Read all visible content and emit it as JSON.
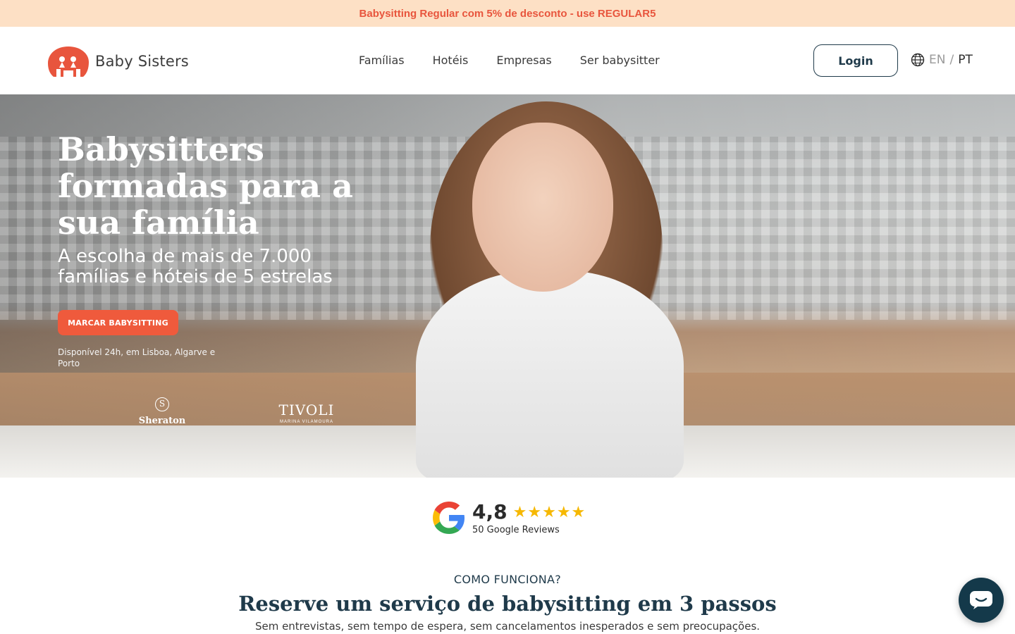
{
  "promo": {
    "text": "Babysitting Regular com 5% de desconto - use REGULAR5"
  },
  "header": {
    "logo_text": "Baby Sisters",
    "nav": [
      {
        "label": "Famílias"
      },
      {
        "label": "Hotéis"
      },
      {
        "label": "Empresas"
      },
      {
        "label": "Ser babysitter"
      }
    ],
    "login_label": "Login",
    "lang": {
      "en": "EN",
      "separator": "/",
      "pt": "PT",
      "icon": "globe-icon"
    }
  },
  "hero": {
    "title": "Babysitters formadas para a sua família",
    "subtitle": "A escolha de mais de 7.000 famílias e hóteis de 5 estrelas",
    "cta_label": "MARCAR BABYSITTING",
    "note": "Disponível 24h, em Lisboa, Algarve e Porto",
    "partners": {
      "sheraton": {
        "mark": "S",
        "name": "Sheraton"
      },
      "tivoli": {
        "name": "TIVOLI",
        "sub": "MARINA VILAMOURA"
      }
    }
  },
  "reviews": {
    "score": "4,8",
    "rating": 4.8,
    "max_rating": 5,
    "count_text": "50 Google Reviews",
    "icon": "google-icon",
    "star_color": "#f6b800"
  },
  "how": {
    "label": "COMO FUNCIONA?",
    "title": "Reserve um serviço de babysitting em 3 passos",
    "subtitle": "Sem entrevistas, sem tempo de espera, sem cancelamentos inesperados e sem preocupações."
  },
  "chat": {
    "icon": "chat-icon"
  },
  "colors": {
    "accent": "#ef5a3c",
    "promo_bg": "#fde0c5",
    "promo_text": "#e8553d",
    "navy": "#1f3a4a"
  }
}
